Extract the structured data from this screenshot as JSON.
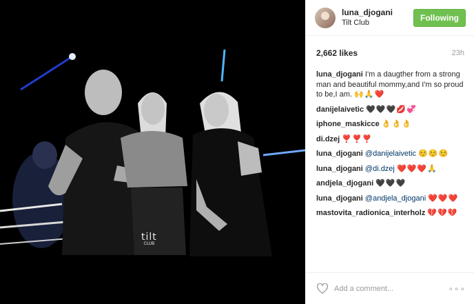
{
  "header": {
    "username": "luna_djogani",
    "location": "Tilt Club",
    "follow_label": "Following"
  },
  "meta": {
    "likes": "2,662 likes",
    "time": "23h"
  },
  "comments": [
    {
      "user": "luna_djogani",
      "text": "I'm a daugther from a strong man and beautiful mommy,and I'm so proud to be,I am.",
      "emoji": "🙌🙏❤️"
    },
    {
      "user": "danijelaivetic",
      "text": "",
      "emoji": "🖤🖤🖤💋💞"
    },
    {
      "user": "iphone_maskicce",
      "text": "",
      "emoji": "👌👌👌"
    },
    {
      "user": "di.dzej",
      "text": "",
      "emoji": "❣️❣️❣️"
    },
    {
      "user": "luna_djogani",
      "mention": "@danijelaivetic",
      "text": "",
      "emoji": "☺️☺️☺️"
    },
    {
      "user": "luna_djogani",
      "mention": "@di.dzej",
      "text": "",
      "emoji": "❤️❤️❤️🙏"
    },
    {
      "user": "andjela_djogani",
      "text": "",
      "emoji": "🖤🖤🖤"
    },
    {
      "user": "luna_djogani",
      "mention": "@andjela_djogani",
      "text": "",
      "emoji": "❤️❤️❤️"
    },
    {
      "user": "mastovita_radionica_interholz",
      "text": "",
      "emoji": "💔💔💔"
    }
  ],
  "footer": {
    "add_comment_placeholder": "Add a comment...",
    "more_glyph": "∘∘∘"
  },
  "photo": {
    "watermark": "tilt",
    "watermark_sub": "CLUB"
  },
  "colors": {
    "follow_bg": "#70c050",
    "mention": "#003569",
    "muted": "#999999"
  },
  "icons": {
    "like": "heart-outline-icon",
    "more": "more-options-icon"
  }
}
